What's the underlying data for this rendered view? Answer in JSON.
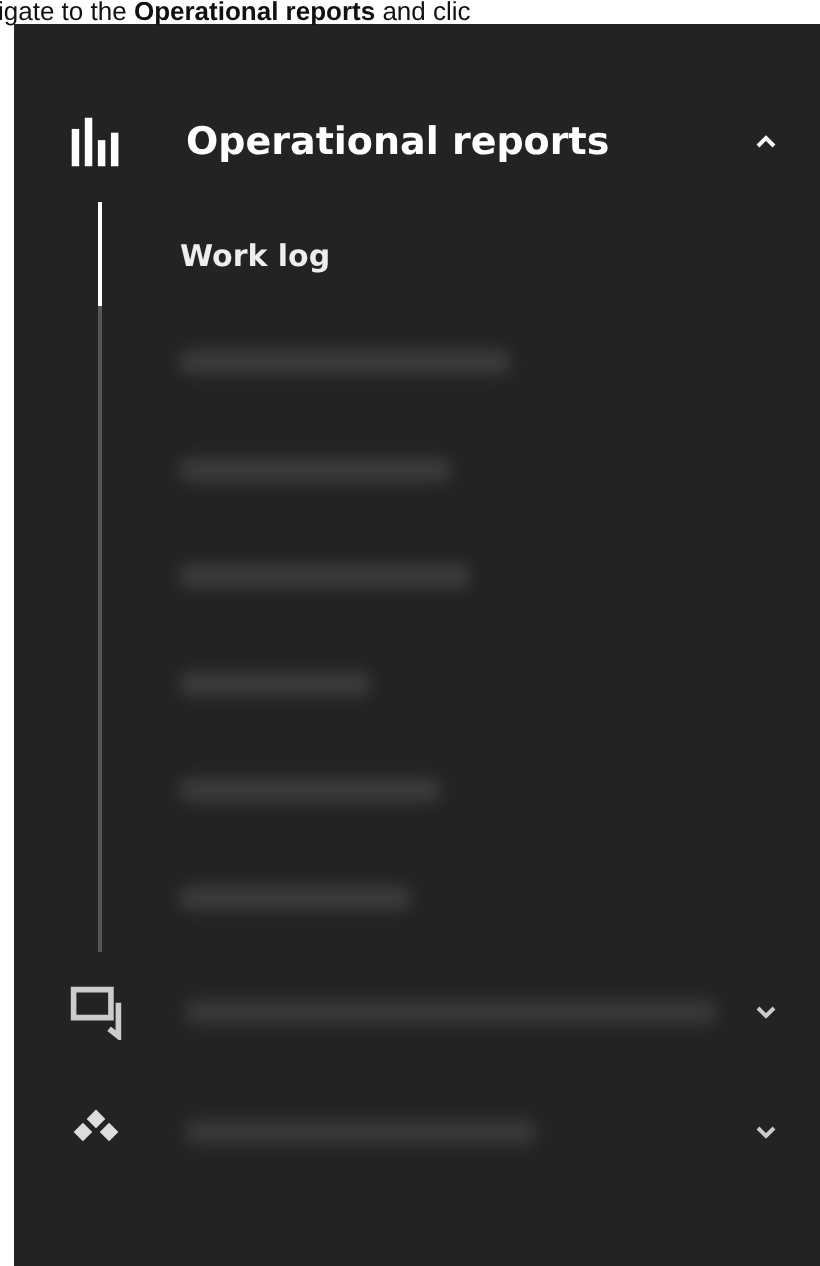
{
  "caption": "igate to the **Operational reports** and clic",
  "sections": [
    {
      "kind": "bars",
      "label": "Operational reports",
      "blurred": false,
      "expanded": true,
      "items": [
        {
          "label": "Work log",
          "blurred": false,
          "selected": true
        },
        {
          "blurred": true,
          "selected": false
        },
        {
          "blurred": true,
          "selected": false
        },
        {
          "blurred": true,
          "selected": false
        },
        {
          "blurred": true,
          "selected": false
        },
        {
          "blurred": true,
          "selected": false
        },
        {
          "blurred": true,
          "selected": false
        }
      ]
    },
    {
      "kind": "chat",
      "blurred": true,
      "expanded": false
    },
    {
      "kind": "diamonds",
      "blurred": true,
      "expanded": false
    }
  ]
}
